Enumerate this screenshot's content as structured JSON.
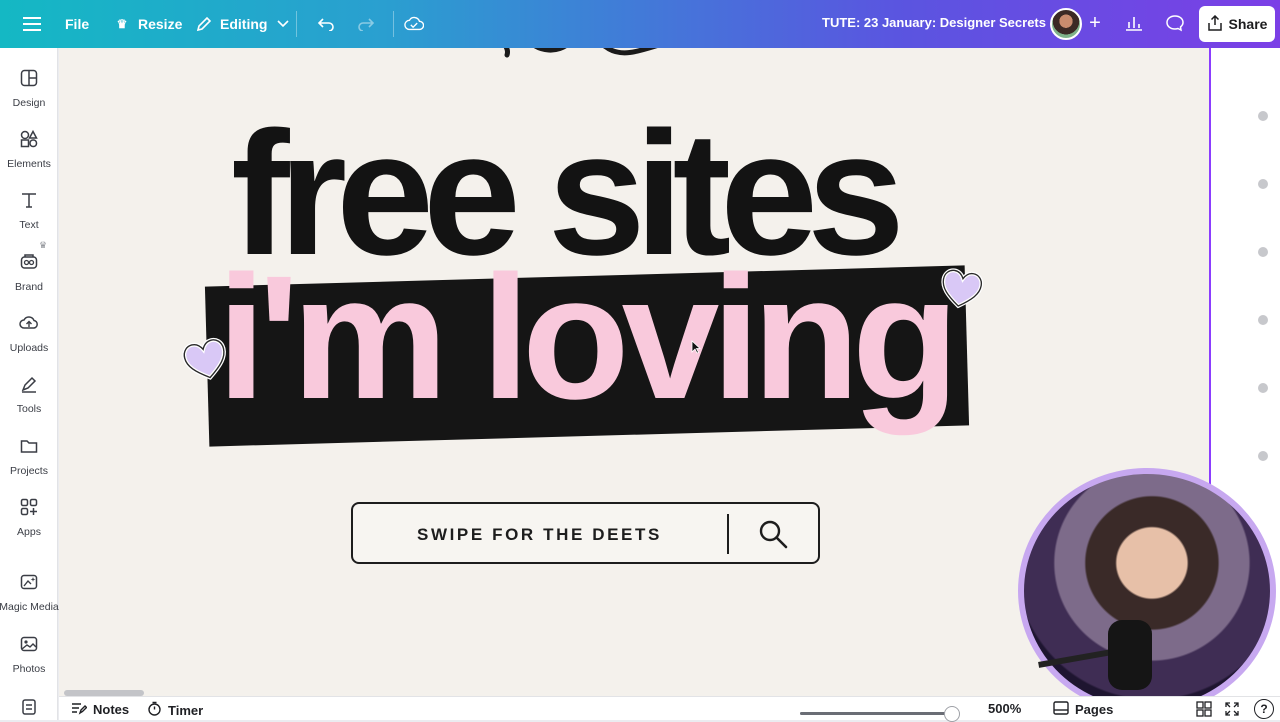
{
  "topbar": {
    "menu_icon": "hamburger-icon",
    "file_label": "File",
    "resize_label": "Resize",
    "editing_label": "Editing",
    "doc_title": "TUTE: 23 January: Designer Secrets",
    "share_label": "Share",
    "add_label": "+"
  },
  "sidebar": {
    "items": [
      {
        "label": "Design",
        "icon": "design-icon"
      },
      {
        "label": "Elements",
        "icon": "elements-icon"
      },
      {
        "label": "Text",
        "icon": "text-icon"
      },
      {
        "label": "Brand",
        "icon": "brand-icon"
      },
      {
        "label": "Uploads",
        "icon": "uploads-icon"
      },
      {
        "label": "Tools",
        "icon": "tools-icon"
      },
      {
        "label": "Projects",
        "icon": "projects-icon"
      },
      {
        "label": "Apps",
        "icon": "apps-icon"
      },
      {
        "label": "Magic Media",
        "icon": "magic-media-icon"
      },
      {
        "label": "Photos",
        "icon": "photos-icon"
      }
    ]
  },
  "canvas": {
    "headline_line1": "free sites",
    "headline_line2": "i'm loving",
    "search_text": "SWIPE FOR THE DEETS",
    "colors": {
      "background": "#f4f1ec",
      "pink": "#f9c9dc",
      "black": "#151515",
      "heart": "#d9c8f6"
    }
  },
  "bottombar": {
    "notes_label": "Notes",
    "timer_label": "Timer",
    "zoom_value": "500%",
    "zoom_level": 0.95,
    "pages_label": "Pages",
    "help_label": "?"
  },
  "accent": {
    "selection": "#8b3dff"
  }
}
